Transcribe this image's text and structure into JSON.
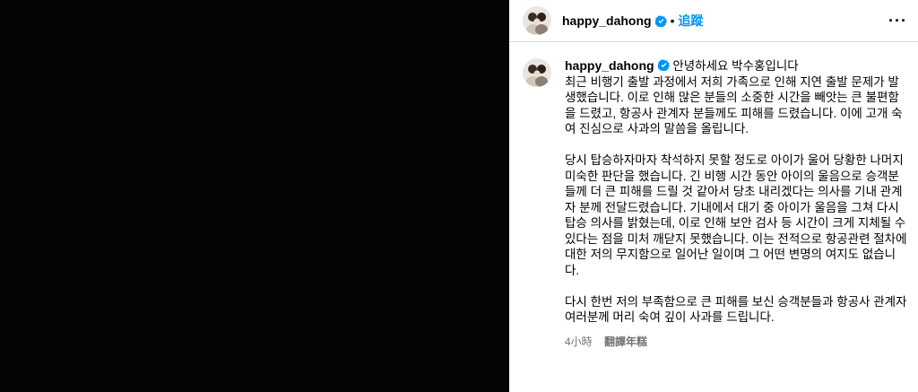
{
  "post": {
    "username": "happy_dahong",
    "separator": "•",
    "follow_label": "追蹤",
    "more_label": "···"
  },
  "caption": {
    "username": "happy_dahong",
    "greeting": "안녕하세요 박수홍입니다",
    "body": "최근 비행기 출발 과정에서 저희 가족으로 인해 지연 출발 문제가 발생했습니다. 이로 인해 많은 분들의 소중한 시간을 빼앗는 큰 불편함을 드렸고, 항공사 관계자 분들께도 피해를 드렸습니다. 이에 고개 숙여 진심으로 사과의 말씀을 올립니다.\n\n당시 탑승하자마자 착석하지 못할 정도로 아이가 울어 당황한 나머지 미숙한 판단을 했습니다. 긴 비행 시간 동안 아이의 울음으로 승객분들께 더 큰 피해를 드릴 것 같아서 당초 내리겠다는 의사를 기내 관계자 분께 전달드렸습니다. 기내에서 대기 중 아이가 울음을 그쳐 다시 탑승 의사를 밝혔는데, 이로 인해 보안 검사 등 시간이 크게 지체될 수 있다는 점을 미처 깨닫지 못했습니다. 이는 전적으로 항공관련 절차에 대한 저의 무지함으로 일어난 일이며 그 어떤 변명의 여지도 없습니다.\n\n다시 한번 저의 부족함으로 큰 피해를 보신 승객분들과 항공사 관계자 여러분께 머리 숙여 깊이 사과를 드립니다.",
    "time_ago": "4小時",
    "translate_label": "翻譯年糕"
  },
  "colors": {
    "link": "#0095f6",
    "verified": "#0095f6",
    "muted": "#737373"
  },
  "icons": [
    "verified-badge-icon",
    "more-options-icon"
  ]
}
